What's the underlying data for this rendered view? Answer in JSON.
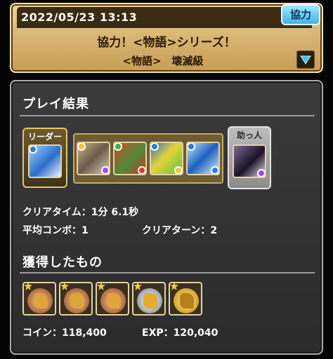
{
  "header": {
    "datetime": "2022/05/23 13:13",
    "mode_badge": "協力",
    "quest_title": "協力！<物語>シリーズ！",
    "quest_subtitle": "<物語>　壊滅級"
  },
  "result": {
    "section_title": "プレイ結果",
    "leader_label": "リーダー",
    "helper_label": "助っ人",
    "team": [
      {
        "slot": "leader",
        "icon": "blue-white-monster-portrait"
      },
      {
        "slot": "sub1",
        "icon": "armored-knight-portrait"
      },
      {
        "slot": "sub2",
        "icon": "red-green-dragon-portrait"
      },
      {
        "slot": "sub3",
        "icon": "yellow-green-weapon-portrait"
      },
      {
        "slot": "sub4",
        "icon": "blue-ice-warrior-portrait"
      },
      {
        "slot": "helper",
        "icon": "dark-haired-girl-portrait"
      }
    ],
    "clear_time_label": "クリアタイム：",
    "clear_time_value": "1分 6.1秒",
    "avg_combo_label": "平均コンボ：",
    "avg_combo_value": "1",
    "clear_turn_label": "クリアターン：",
    "clear_turn_value": "2"
  },
  "rewards": {
    "section_title": "獲得したもの",
    "items": [
      {
        "icon": "bronze-coin-dragon-icon"
      },
      {
        "icon": "bronze-coin-dragon-icon"
      },
      {
        "icon": "bronze-coin-dragon-icon"
      },
      {
        "icon": "silver-coin-dragon-icon"
      },
      {
        "icon": "gold-coin-dragon-icon"
      }
    ],
    "coin_label": "コイン：",
    "coin_value": "118,400",
    "exp_label": "EXP：",
    "exp_value": "120,040"
  },
  "colors": {
    "header_gold": "#d9b774",
    "panel_bg": "#333333",
    "badge_blue": "#3fb4e6",
    "leader_frame": "#e5c56a",
    "helper_frame": "#bcbcbc"
  }
}
